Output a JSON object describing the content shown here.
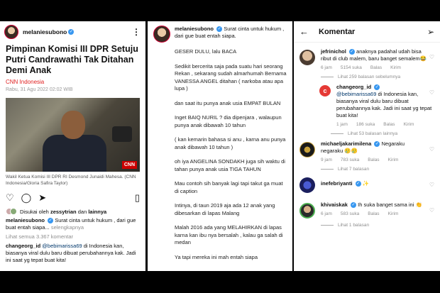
{
  "post_left": {
    "username": "melaniesubono",
    "headline": "Pimpinan Komisi III DPR Setuju Putri Candrawathi Tak Ditahan Demi Anak",
    "source": "CNN Indonesia",
    "date": "Rabu, 31 Agu 2022 02:02 WIB",
    "photo_badge": "CNN",
    "photo_caption": "Wakil Ketua Komisi III DPR RI Desmond Junaidi Mahesa. (CNN Indonesia/Gloria Safira Taylor)",
    "liked_prefix": "Disukai oleh",
    "liked_user": "zessytrian",
    "liked_and": "dan",
    "liked_rest": "lainnya",
    "caption_user": "melaniesubono",
    "caption_text": "Surat cinta untuk hukum , dari gue buat entah siapa...",
    "caption_more": "selengkapnya",
    "view_comments": "Lihat semua 3.367 komentar",
    "comment_user": "changeorg_id",
    "comment_mention": "@bebimarissa69",
    "comment_text": "di Indonesia kan, biasanya viral dulu baru dibuat perubahannya kak. Jadi ini saat yg tepat buat kita!"
  },
  "post_middle": {
    "username": "melaniesubono",
    "intro": "Surat cinta untuk hukum , dari gue buat entah siapa.",
    "paragraphs": [
      "GESER DULU, lalu BACA",
      "Sedikit bercerita saja pada suatu hari seorang Rekan , sekarang sudah almarhumah Bernama VANESSA ANGEL ditahan ( narkoba atau apa lupa )",
      "dan saat itu punya anak usia EMPAT BULAN",
      "Inget BAIQ NURIL ? dia dipenjara , walaupun punya anak dibawah 10 tahun",
      "( kan kemarin bahasa si anu , karna anu punya anak dibawah 10 tahun )",
      "oh iya ANGELINA SONDAKH juga sih waktu di tahan punya anak usia TIGA TAHUN",
      "Mau contoh sih banyak lagi tapi takut ga muat di caption",
      "Intinya, di taun 2019 aja ada 12 anak yang dibesarkan di lapas Malang",
      "Malah 2016 ada yang MELAHIRKAN di lapas karna kan ibu nya bersalah , kalau ga salah di medan",
      "Ya tapi mereka ini mah entah siapa"
    ]
  },
  "comments_panel": {
    "title": "Komentar",
    "comments": [
      {
        "user": "jefrinichol",
        "text": "anaknya padahal udah bisa ribut di club malem, baru banget semalem😂",
        "time": "6 jam",
        "likes": "5154 suka",
        "reply": "Balas",
        "send": "Kirim",
        "replies_label": "Lihat 259 balasan sebelumnya"
      },
      {
        "user": "changeorg_id",
        "mention": "@bebimarissa69",
        "text": "di Indonesia kan, biasanya viral dulu baru dibuat perubahannya kak. Jadi ini saat yg tepat buat kita!",
        "time": "1 jam",
        "likes": "186 suka",
        "reply": "Balas",
        "send": "Kirim",
        "replies_label": "Lihat 53 balasan lainnya"
      },
      {
        "user": "michaeljakarimilena",
        "text": "Negaraku negaraku 🥲🥲",
        "time": "9 jam",
        "likes": "783 suka",
        "reply": "Balas",
        "send": "Kirim",
        "replies_label": "Lihat 7 balasan"
      },
      {
        "user": "inefebriyanti",
        "text": "✨",
        "time": "",
        "likes": "",
        "reply": "",
        "send": "",
        "replies_label": ""
      },
      {
        "user": "khivaiskak",
        "text": "Ih suka banget sama ini 👏",
        "time": "6 jam",
        "likes": "583 suka",
        "reply": "Balas",
        "send": "Kirim",
        "replies_label": "Lihat 1 balasan"
      }
    ]
  }
}
